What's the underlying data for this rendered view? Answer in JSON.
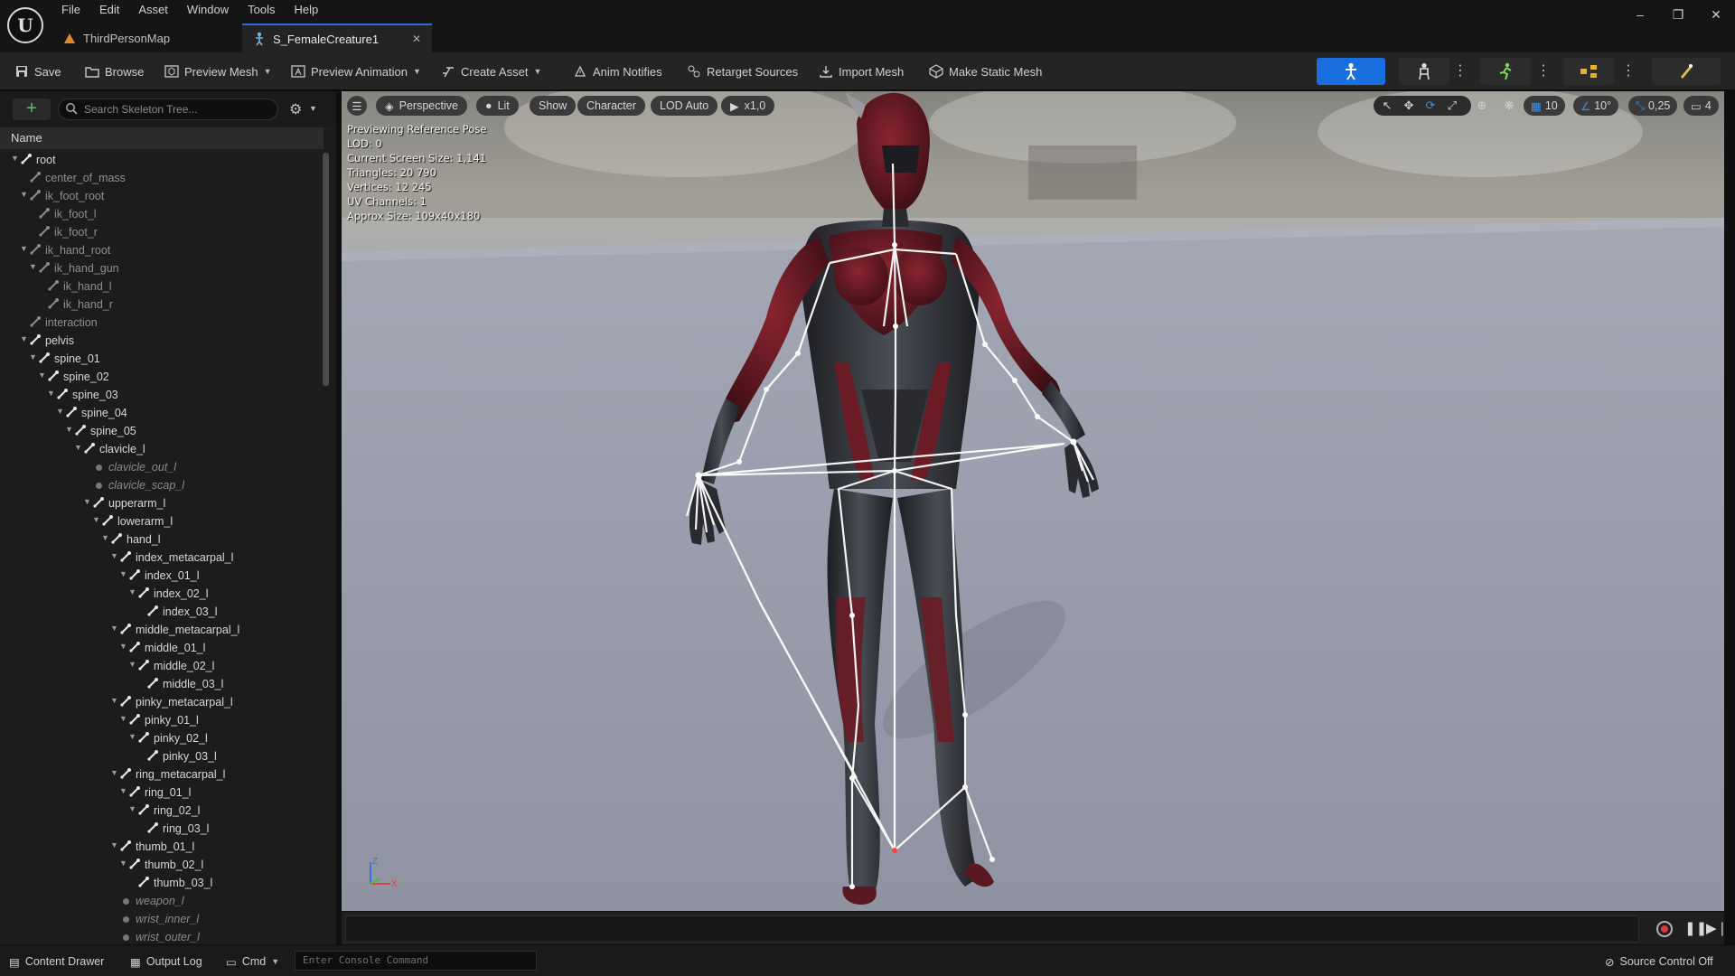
{
  "menu": [
    "File",
    "Edit",
    "Asset",
    "Window",
    "Tools",
    "Help"
  ],
  "tabs": [
    {
      "label": "ThirdPersonMap",
      "active": false
    },
    {
      "label": "S_FemaleCreature1",
      "active": true
    }
  ],
  "window_controls": {
    "minimize": "–",
    "restore": "❐",
    "close": "✕"
  },
  "toolbar": {
    "save": "Save",
    "browse": "Browse",
    "preview_mesh": "Preview Mesh",
    "preview_animation": "Preview Animation",
    "create_asset": "Create Asset",
    "anim_notifies": "Anim Notifies",
    "retarget_sources": "Retarget Sources",
    "import_mesh": "Import Mesh",
    "make_static_mesh": "Make Static Mesh",
    "accent": "#1a6fe0"
  },
  "skeleton_tree": {
    "search_placeholder": "Search Skeleton Tree...",
    "header": "Name",
    "bones": [
      {
        "name": "root",
        "depth": 0,
        "expanded": true,
        "kind": "bone"
      },
      {
        "name": "center_of_mass",
        "depth": 1,
        "kind": "dim"
      },
      {
        "name": "ik_foot_root",
        "depth": 1,
        "expanded": true,
        "kind": "dim"
      },
      {
        "name": "ik_foot_l",
        "depth": 2,
        "kind": "dim"
      },
      {
        "name": "ik_foot_r",
        "depth": 2,
        "kind": "dim"
      },
      {
        "name": "ik_hand_root",
        "depth": 1,
        "expanded": true,
        "kind": "dim"
      },
      {
        "name": "ik_hand_gun",
        "depth": 2,
        "expanded": true,
        "kind": "dim"
      },
      {
        "name": "ik_hand_l",
        "depth": 3,
        "kind": "dim"
      },
      {
        "name": "ik_hand_r",
        "depth": 3,
        "kind": "dim"
      },
      {
        "name": "interaction",
        "depth": 1,
        "kind": "dim"
      },
      {
        "name": "pelvis",
        "depth": 1,
        "expanded": true,
        "kind": "bone"
      },
      {
        "name": "spine_01",
        "depth": 2,
        "expanded": true,
        "kind": "bone"
      },
      {
        "name": "spine_02",
        "depth": 3,
        "expanded": true,
        "kind": "bone"
      },
      {
        "name": "spine_03",
        "depth": 4,
        "expanded": true,
        "kind": "bone"
      },
      {
        "name": "spine_04",
        "depth": 5,
        "expanded": true,
        "kind": "bone"
      },
      {
        "name": "spine_05",
        "depth": 6,
        "expanded": true,
        "kind": "bone"
      },
      {
        "name": "clavicle_l",
        "depth": 7,
        "expanded": true,
        "kind": "bone"
      },
      {
        "name": "clavicle_out_l",
        "depth": 8,
        "kind": "socket"
      },
      {
        "name": "clavicle_scap_l",
        "depth": 8,
        "kind": "socket"
      },
      {
        "name": "upperarm_l",
        "depth": 8,
        "expanded": true,
        "kind": "bone"
      },
      {
        "name": "lowerarm_l",
        "depth": 9,
        "expanded": true,
        "kind": "bone"
      },
      {
        "name": "hand_l",
        "depth": 10,
        "expanded": true,
        "kind": "bone"
      },
      {
        "name": "index_metacarpal_l",
        "depth": 11,
        "expanded": true,
        "kind": "bone"
      },
      {
        "name": "index_01_l",
        "depth": 12,
        "expanded": true,
        "kind": "bone"
      },
      {
        "name": "index_02_l",
        "depth": 13,
        "expanded": true,
        "kind": "bone"
      },
      {
        "name": "index_03_l",
        "depth": 14,
        "kind": "bone"
      },
      {
        "name": "middle_metacarpal_l",
        "depth": 11,
        "expanded": true,
        "kind": "bone"
      },
      {
        "name": "middle_01_l",
        "depth": 12,
        "expanded": true,
        "kind": "bone"
      },
      {
        "name": "middle_02_l",
        "depth": 13,
        "expanded": true,
        "kind": "bone"
      },
      {
        "name": "middle_03_l",
        "depth": 14,
        "kind": "bone"
      },
      {
        "name": "pinky_metacarpal_l",
        "depth": 11,
        "expanded": true,
        "kind": "bone"
      },
      {
        "name": "pinky_01_l",
        "depth": 12,
        "expanded": true,
        "kind": "bone"
      },
      {
        "name": "pinky_02_l",
        "depth": 13,
        "expanded": true,
        "kind": "bone"
      },
      {
        "name": "pinky_03_l",
        "depth": 14,
        "kind": "bone"
      },
      {
        "name": "ring_metacarpal_l",
        "depth": 11,
        "expanded": true,
        "kind": "bone"
      },
      {
        "name": "ring_01_l",
        "depth": 12,
        "expanded": true,
        "kind": "bone"
      },
      {
        "name": "ring_02_l",
        "depth": 13,
        "expanded": true,
        "kind": "bone"
      },
      {
        "name": "ring_03_l",
        "depth": 14,
        "kind": "bone"
      },
      {
        "name": "thumb_01_l",
        "depth": 11,
        "expanded": true,
        "kind": "bone"
      },
      {
        "name": "thumb_02_l",
        "depth": 12,
        "expanded": true,
        "kind": "bone"
      },
      {
        "name": "thumb_03_l",
        "depth": 13,
        "kind": "bone"
      },
      {
        "name": "weapon_l",
        "depth": 11,
        "kind": "socket"
      },
      {
        "name": "wrist_inner_l",
        "depth": 11,
        "kind": "socket"
      },
      {
        "name": "wrist_outer_l",
        "depth": 11,
        "kind": "socket"
      }
    ]
  },
  "viewport": {
    "perspective": "Perspective",
    "lit": "Lit",
    "show": "Show",
    "character": "Character",
    "lod": "LOD Auto",
    "play_rate": "x1,0",
    "grid_snap": "10",
    "rotation_snap": "10°",
    "scale_snap": "0,25",
    "camera_speed": "4",
    "stats": [
      "Previewing Reference Pose",
      "LOD: 0",
      "Current Screen Size: 1,141",
      "Triangles: 20 790",
      "Vertices: 12 245",
      "UV Channels: 1",
      "Approx Size: 109x40x180"
    ],
    "axis_z": "Z",
    "axis_x": "X"
  },
  "statusbar": {
    "content_drawer": "Content Drawer",
    "output_log": "Output Log",
    "cmd": "Cmd",
    "console_placeholder": "Enter Console Command",
    "source_control": "Source Control Off"
  }
}
